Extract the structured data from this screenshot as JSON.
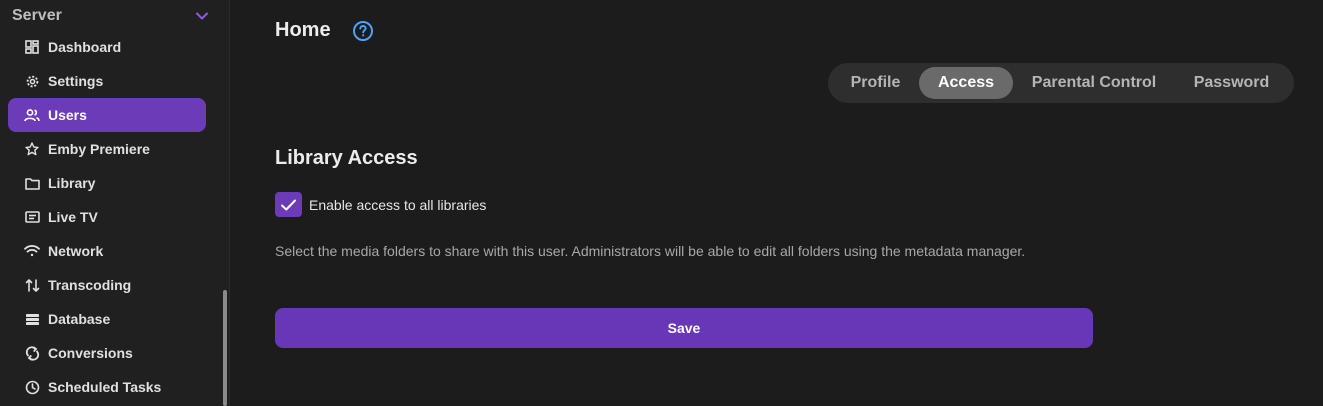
{
  "sidebar": {
    "section_title": "Server",
    "items": [
      {
        "label": "Dashboard",
        "icon": "dashboard-icon",
        "active": false
      },
      {
        "label": "Settings",
        "icon": "gear-icon",
        "active": false
      },
      {
        "label": "Users",
        "icon": "users-icon",
        "active": true
      },
      {
        "label": "Emby Premiere",
        "icon": "star-icon",
        "active": false
      },
      {
        "label": "Library",
        "icon": "folder-icon",
        "active": false
      },
      {
        "label": "Live TV",
        "icon": "live-tv-icon",
        "active": false
      },
      {
        "label": "Network",
        "icon": "wifi-icon",
        "active": false
      },
      {
        "label": "Transcoding",
        "icon": "transcoding-icon",
        "active": false
      },
      {
        "label": "Database",
        "icon": "database-icon",
        "active": false
      },
      {
        "label": "Conversions",
        "icon": "sync-icon",
        "active": false
      },
      {
        "label": "Scheduled Tasks",
        "icon": "clock-icon",
        "active": false
      }
    ]
  },
  "header": {
    "title": "Home",
    "help_icon": "help-circle-icon"
  },
  "tabs": [
    {
      "label": "Profile",
      "active": false
    },
    {
      "label": "Access",
      "active": true
    },
    {
      "label": "Parental Control",
      "active": false
    },
    {
      "label": "Password",
      "active": false
    }
  ],
  "library_access": {
    "heading": "Library Access",
    "checkbox_label": "Enable access to all libraries",
    "checkbox_checked": true,
    "help_text": "Select the media folders to share with this user. Administrators will be able to edit all folders using the metadata manager."
  },
  "save_label": "Save",
  "colors": {
    "accent": "#6b3bb8",
    "background": "#1c1c1c",
    "sidebar": "#202020",
    "tab_track": "#2e2e2e",
    "tab_active": "#6a6a6a"
  }
}
